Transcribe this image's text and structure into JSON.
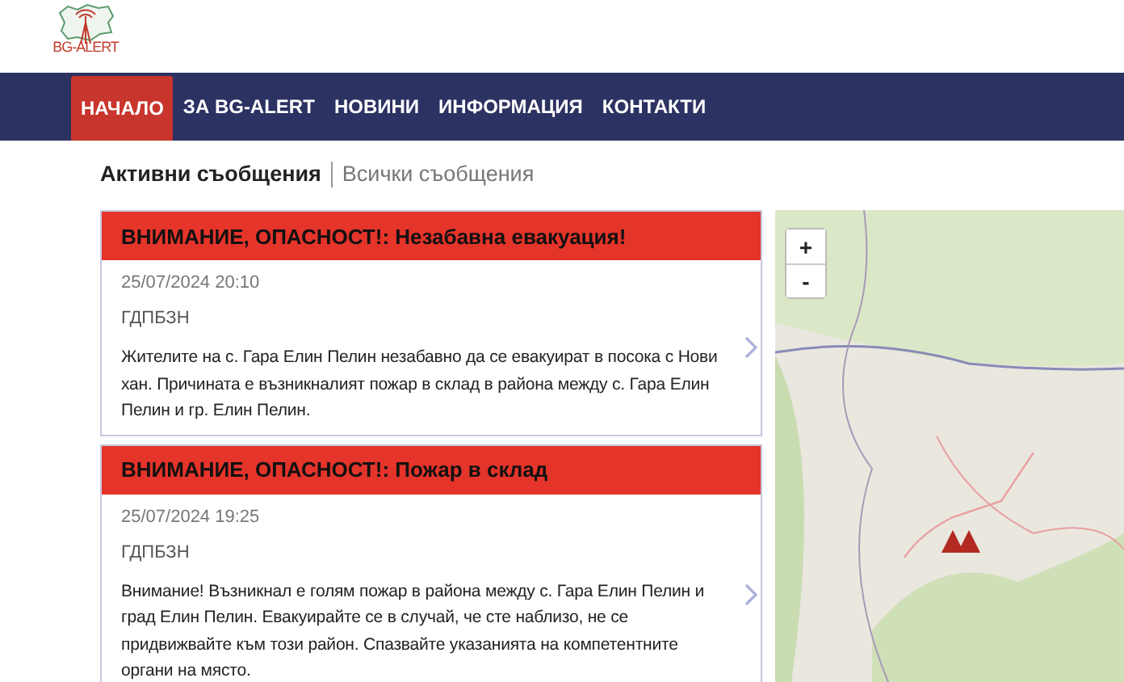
{
  "header": {
    "logo_text": "BG-ALERT"
  },
  "nav": [
    {
      "label": "НАЧАЛО",
      "selected": true
    },
    {
      "label": "ЗА BG-ALERT",
      "selected": false
    },
    {
      "label": "НОВИНИ",
      "selected": false
    },
    {
      "label": "ИНФОРМАЦИЯ",
      "selected": false
    },
    {
      "label": "КОНТАКТИ",
      "selected": false
    }
  ],
  "message_tabs": [
    {
      "label": "Активни съобщения",
      "selected": true
    },
    {
      "label": "Всички съобщения",
      "selected": false
    }
  ],
  "alerts": [
    {
      "title": "ВНИМАНИЕ, ОПАСНОСТ!: Незабавна евакуация!",
      "date": "25/07/2024 20:10",
      "source": "ГДПБЗН",
      "text": "Жителите на с. Гара Елин Пелин незабавно да се евакуират в посока с Нови хан. Причината е възникналият пожар в склад в района между с. Гара Елин Пелин и гр. Елин Пелин."
    },
    {
      "title": "ВНИМАНИЕ, ОПАСНОСТ!: Пожар в склад",
      "date": "25/07/2024 19:25",
      "source": "ГДПБЗН",
      "text": "Внимание! Възникнал е голям пожар в района между с. Гара Елин Пелин и град Елин Пелин. Евакуирайте се в случай, че сте наблизо, не се придвижвайте към този район. Спазвайте указанията на компетентните органи на място."
    }
  ],
  "map": {
    "zoom_in": "+",
    "zoom_out": "-"
  }
}
